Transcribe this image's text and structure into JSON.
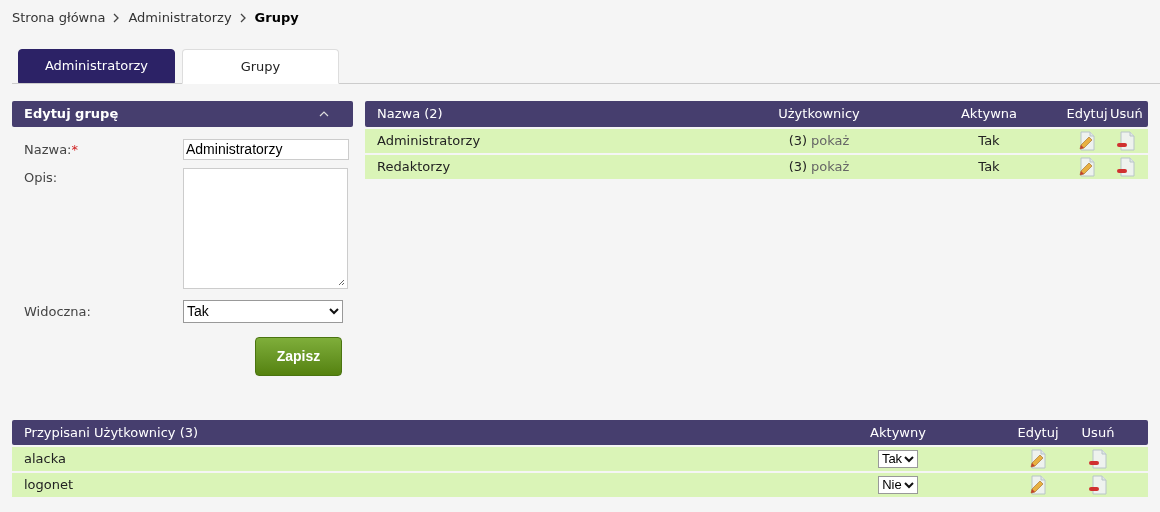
{
  "breadcrumb": [
    {
      "label": "Strona główna",
      "current": false
    },
    {
      "label": "Administratorzy",
      "current": false
    },
    {
      "label": "Grupy",
      "current": true
    }
  ],
  "tabs": [
    {
      "label": "Administratorzy",
      "selected": false
    },
    {
      "label": "Grupy",
      "selected": true
    }
  ],
  "edit_panel": {
    "title": "Edytuj grupę",
    "fields": [
      {
        "kind": "text",
        "label": "Nazwa:",
        "required_mark": "*",
        "value": "Administratorzy"
      },
      {
        "kind": "textarea",
        "label": "Opis:"
      },
      {
        "kind": "select",
        "label": "Widoczna:",
        "value": "Tak"
      }
    ],
    "save_button": "Zapisz"
  },
  "groups_table": {
    "columns": [
      "Nazwa (2)",
      "Użytkownicy",
      "Aktywna",
      "Edytuj",
      "Usuń"
    ],
    "rows": [
      {
        "name": "Administratorzy",
        "count": "(3)",
        "link": "pokaż",
        "active": "Tak"
      },
      {
        "name": "Redaktorzy",
        "count": "(3)",
        "link": "pokaż",
        "active": "Tak"
      }
    ]
  },
  "users_table": {
    "columns": [
      "Przypisani Użytkownicy (3)",
      "Aktywny",
      "Edytuj",
      "Usuń"
    ],
    "rows": [
      {
        "name": "alacka",
        "active": "Tak"
      },
      {
        "name": "logonet",
        "active": "Nie"
      }
    ]
  }
}
